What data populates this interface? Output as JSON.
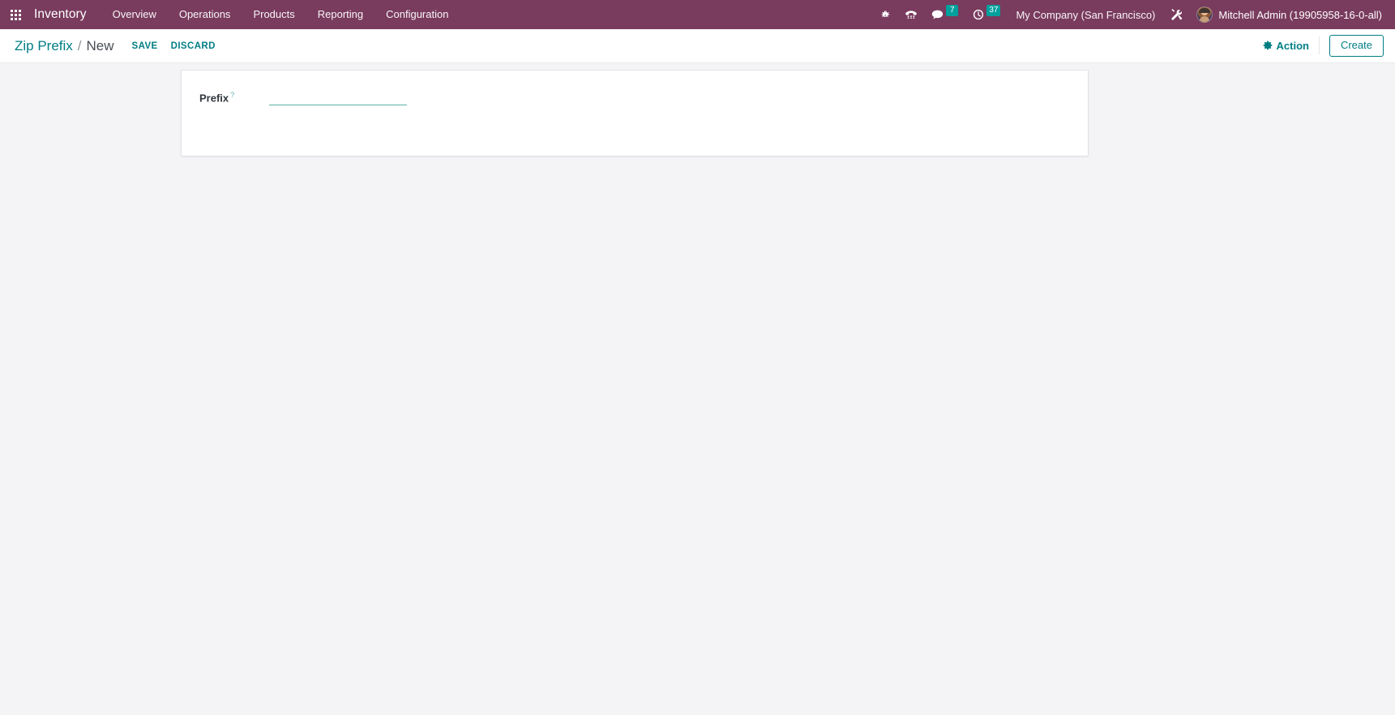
{
  "navbar": {
    "apps_icon": "apps-grid-icon",
    "brand": "Inventory",
    "menu": [
      {
        "label": "Overview"
      },
      {
        "label": "Operations"
      },
      {
        "label": "Products"
      },
      {
        "label": "Reporting"
      },
      {
        "label": "Configuration"
      }
    ],
    "systray": {
      "bug_icon": "bug-icon",
      "voip_icon": "phone-keypad-icon",
      "messages_icon": "message-bubble-icon",
      "messages_count": "7",
      "activities_icon": "clock-icon",
      "activities_count": "37",
      "company": "My Company (San Francisco)",
      "debug_icon": "tools-icon",
      "avatar_icon": "user-avatar",
      "user": "Mitchell Admin (19905958-16-0-all)",
      "badge_color": "#00a09d"
    },
    "background_color": "#793b5e"
  },
  "control_panel": {
    "breadcrumb": {
      "parent": "Zip Prefix",
      "separator": "/",
      "current": "New"
    },
    "save_label": "SAVE",
    "discard_label": "DISCARD",
    "action_icon": "gear-icon",
    "action_label": "Action",
    "create_label": "Create",
    "accent_color": "#017e84"
  },
  "form": {
    "fields": [
      {
        "label": "Prefix",
        "help_marker": "?",
        "value": "",
        "placeholder": ""
      }
    ]
  }
}
